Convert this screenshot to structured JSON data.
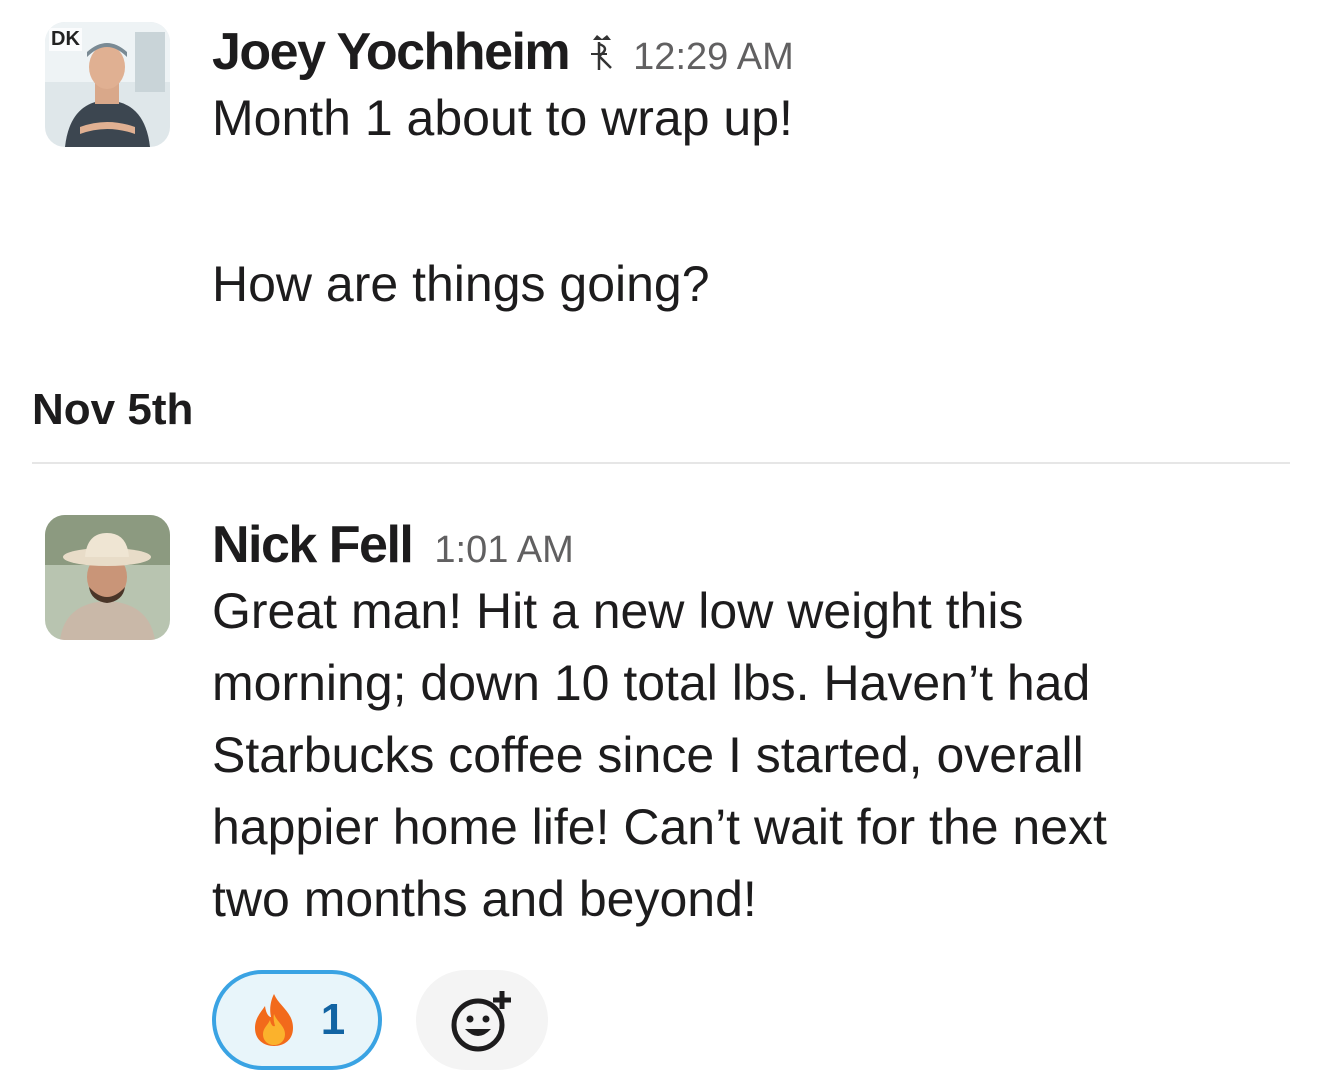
{
  "messages": [
    {
      "author": "Joey Yochheim",
      "time": "12:29 AM",
      "status_icon": "dk-crown-icon",
      "avatar_badge": "DK",
      "lines": [
        "Month 1 about to wrap up!",
        "",
        "How are things going?"
      ]
    },
    {
      "author": "Nick Fell",
      "time": "1:01 AM",
      "lines": [
        "Great man! Hit a new low weight this",
        "morning; down 10 total lbs. Haven’t had",
        "Starbucks coffee since I started, overall",
        "happier home life! Can’t wait for the next",
        "two months and beyond!"
      ]
    }
  ],
  "date_divider": "Nov 5th",
  "reaction": {
    "emoji": "fire-icon",
    "count": "1"
  },
  "add_reaction_icon": "add-emoji-icon",
  "colors": {
    "reaction_border": "#3aa3e3",
    "reaction_bg": "#e8f5fa",
    "reaction_count": "#1264a3"
  }
}
